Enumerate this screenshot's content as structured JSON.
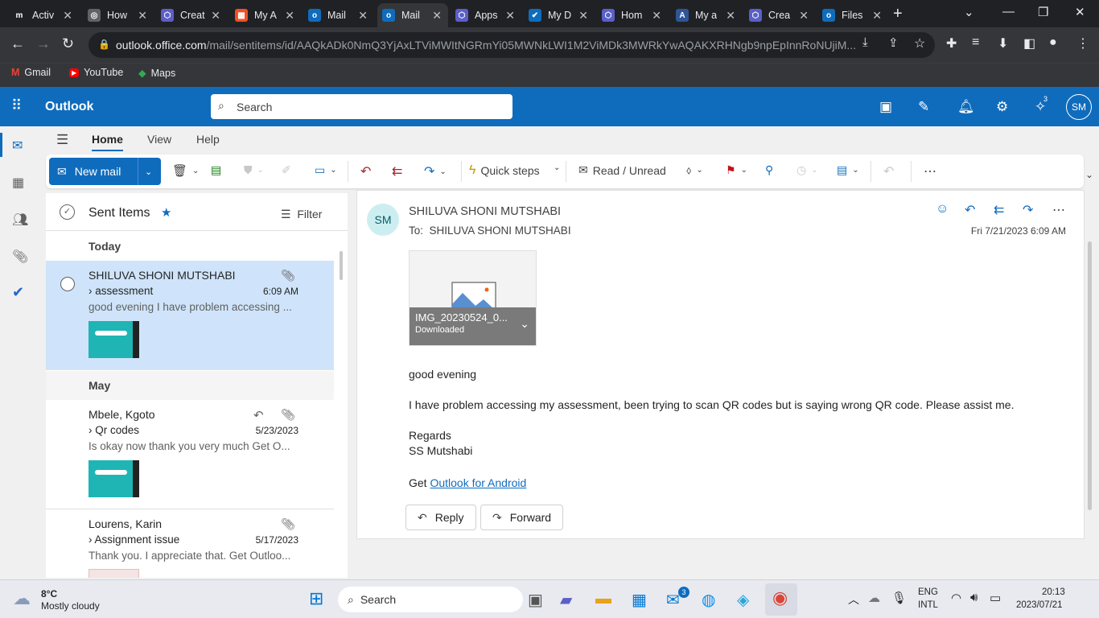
{
  "browser": {
    "tabs": [
      {
        "title": "Activ",
        "icon": "brand-m-icon",
        "color": "#202124",
        "glyph": "m"
      },
      {
        "title": "How",
        "icon": "globe-icon",
        "color": "#5f6368",
        "glyph": "◎"
      },
      {
        "title": "Creat",
        "icon": "hexagon-icon",
        "color": "#5b5fc7",
        "glyph": "⬡"
      },
      {
        "title": "My A",
        "icon": "microsoft-icon",
        "color": "#f25022",
        "glyph": "▦"
      },
      {
        "title": "Mail",
        "icon": "outlook-icon",
        "color": "#0f6cbd",
        "glyph": "o"
      },
      {
        "title": "Mail",
        "icon": "outlook-icon",
        "color": "#0f6cbd",
        "glyph": "o"
      },
      {
        "title": "Apps",
        "icon": "hexagon-icon",
        "color": "#5b5fc7",
        "glyph": "⬡"
      },
      {
        "title": "My D",
        "icon": "check-icon",
        "color": "#0f6cbd",
        "glyph": "✔"
      },
      {
        "title": "Hom",
        "icon": "hexagon-icon",
        "color": "#5b5fc7",
        "glyph": "⬡"
      },
      {
        "title": "My a",
        "icon": "brand-a-icon",
        "color": "#2f5597",
        "glyph": "A"
      },
      {
        "title": "Crea",
        "icon": "hexagon-icon",
        "color": "#5b5fc7",
        "glyph": "⬡"
      },
      {
        "title": "Files",
        "icon": "outlook-icon",
        "color": "#0f6cbd",
        "glyph": "o"
      }
    ],
    "url_host": "outlook.office.com",
    "url_path": "/mail/sentitems/id/AAQkADk0NmQ3YjAxLTViMWItNGRmYi05MWNkLWI1M2ViMDk3MWRkYwAQAKXRHNgb9npEpInnRoNUjiM...",
    "bookmarks": [
      "Gmail",
      "YouTube",
      "Maps"
    ]
  },
  "outlook": {
    "brand": "Outlook",
    "search_placeholder": "Search",
    "avatar": "SM",
    "notif_count": "3",
    "ribbon_tabs": [
      "Home",
      "View",
      "Help"
    ],
    "new_mail": "New mail",
    "quick_steps": "Quick steps",
    "read_unread": "Read / Unread",
    "folder": "Sent Items",
    "filter": "Filter",
    "groups": {
      "today": "Today",
      "may": "May"
    },
    "messages": [
      {
        "from": "SHILUVA SHONI MUTSHABI",
        "subject": "assessment",
        "time": "6:09 AM",
        "preview": "good evening I have problem accessing ..."
      },
      {
        "from": "Mbele, Kgoto",
        "subject": "Qr codes",
        "time": "5/23/2023",
        "preview": "Is okay now thank you very much Get O..."
      },
      {
        "from": "Lourens, Karin",
        "subject": "Assignment issue",
        "time": "5/17/2023",
        "preview": "Thank you. I appreciate that. Get Outloo..."
      }
    ],
    "reading": {
      "sender_initials": "SM",
      "sender": "SHILUVA SHONI MUTSHABI",
      "to_label": "To:",
      "to": "SHILUVA SHONI MUTSHABI",
      "date": "Fri 7/21/2023 6:09 AM",
      "attachment_name": "IMG_20230524_0...",
      "attachment_status": "Downloaded",
      "greeting": "good evening",
      "body": "I have problem accessing my assessment, been trying to scan QR codes but is saying wrong QR code. Please assist me.",
      "regards": "Regards",
      "signature": "SS Mutshabi",
      "get_prefix": "Get ",
      "link": "Outlook for Android",
      "reply": "Reply",
      "forward": "Forward"
    }
  },
  "taskbar": {
    "temp": "8°C",
    "weather": "Mostly cloudy",
    "search": "Search",
    "mail_badge": "3",
    "lang1": "ENG",
    "lang2": "INTL",
    "time": "20:13",
    "date": "2023/07/21"
  }
}
